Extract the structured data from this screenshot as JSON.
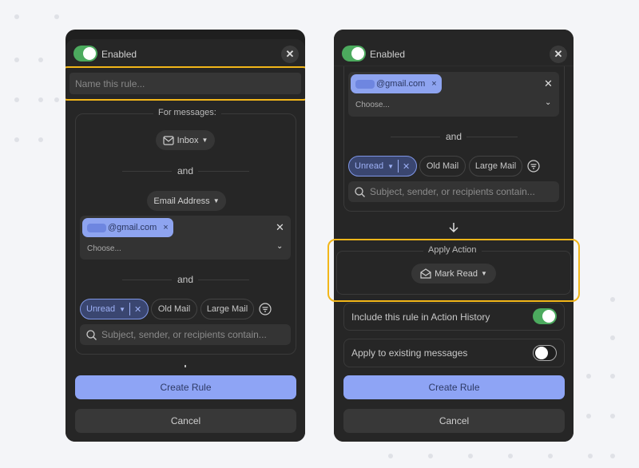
{
  "left": {
    "enabled_label": "Enabled",
    "name_placeholder": "Name this rule...",
    "for_messages": "For messages:",
    "mailbox": "Inbox",
    "and1": "and",
    "field": "Email Address",
    "email_chip": "@gmail.com",
    "choose": "Choose...",
    "and2": "and",
    "filters": [
      "Unread",
      "Old Mail",
      "Large Mail"
    ],
    "search_placeholder": "Subject, sender, or recipients contain...",
    "create": "Create Rule",
    "cancel": "Cancel"
  },
  "right": {
    "enabled_label": "Enabled",
    "email_chip": "@gmail.com",
    "choose": "Choose...",
    "and": "and",
    "filters": [
      "Unread",
      "Old Mail",
      "Large Mail"
    ],
    "search_placeholder": "Subject, sender, or recipients contain...",
    "apply_action": "Apply Action",
    "action": "Mark Read",
    "include_history": "Include this rule in Action History",
    "include_history_on": true,
    "apply_existing": "Apply to existing messages",
    "apply_existing_on": false,
    "create": "Create Rule",
    "cancel": "Cancel"
  },
  "colors": {
    "accent": "#8ea4f5",
    "highlight": "#f2b619",
    "toggle_on": "#4caa5e"
  }
}
